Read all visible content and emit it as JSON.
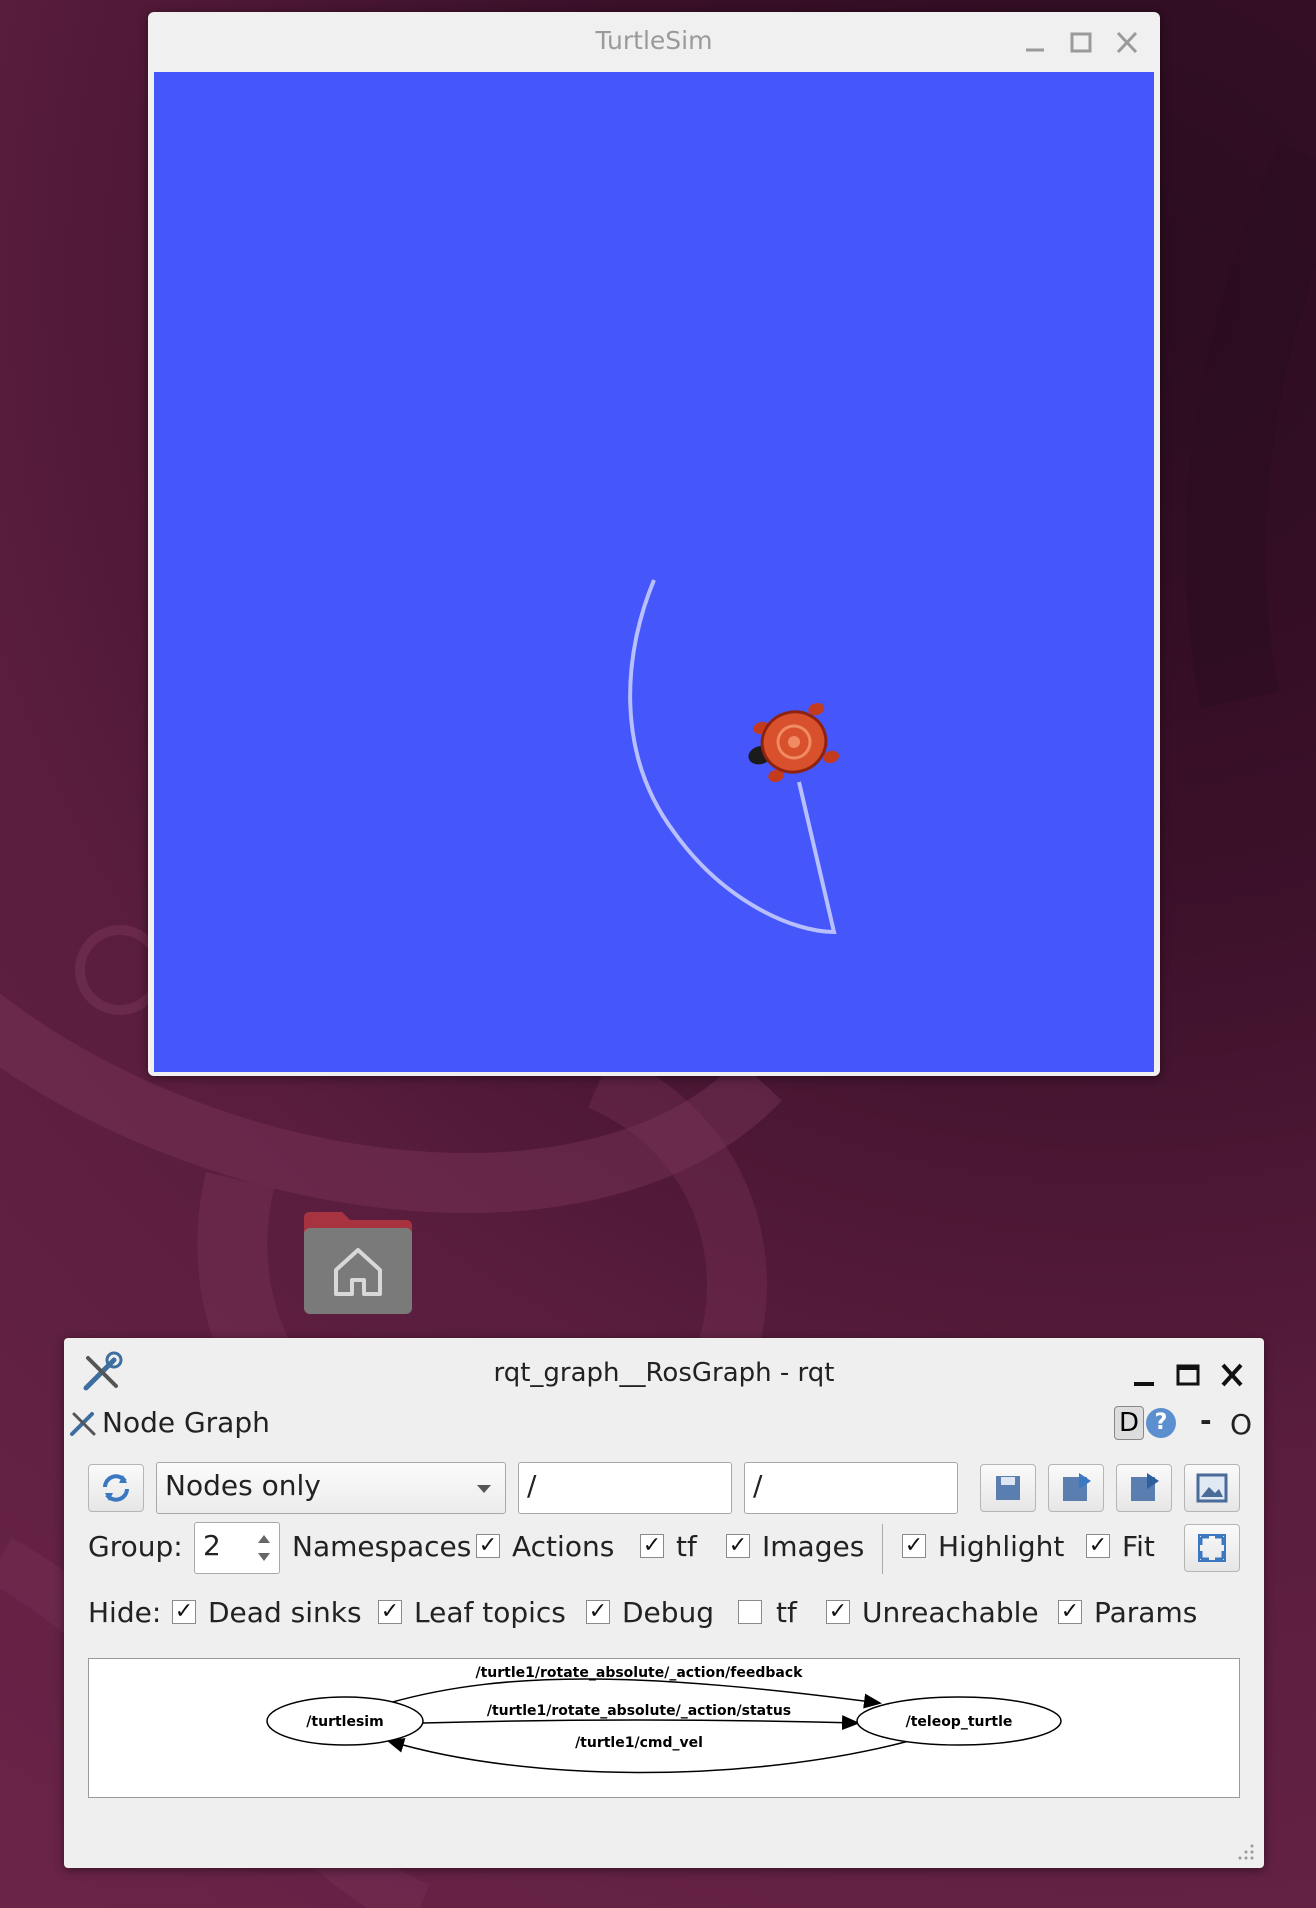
{
  "turtlesim": {
    "title": "TurtleSim",
    "background_color": "#4556fa",
    "icons": [
      "minimize-icon",
      "maximize-icon",
      "close-icon"
    ]
  },
  "desktop": {
    "home_icon": "home-folder-icon"
  },
  "rqt": {
    "title": "rqt_graph__RosGraph - rqt",
    "plugin_title": "Node Graph",
    "plugin_controls": [
      "D",
      "?",
      "-",
      "O"
    ],
    "graph_mode": "Nodes only",
    "ns_filter": "/",
    "topic_filter": "/",
    "group_label": "Group:",
    "group_value": "2",
    "row1_checks": [
      {
        "label": "Namespaces",
        "checked": true
      },
      {
        "label": "Actions",
        "checked": true
      },
      {
        "label": "tf",
        "checked": true
      },
      {
        "label": "Images",
        "checked": true
      },
      {
        "label": "Highlight",
        "checked": true
      },
      {
        "label": "Fit",
        "checked": true
      }
    ],
    "hide_label": "Hide:",
    "hide_checks": [
      {
        "label": "Dead sinks",
        "checked": true
      },
      {
        "label": "Leaf topics",
        "checked": true
      },
      {
        "label": "Debug",
        "checked": true
      },
      {
        "label": "tf",
        "checked": false
      },
      {
        "label": "Unreachable",
        "checked": true
      },
      {
        "label": "Params",
        "checked": true
      }
    ],
    "graph": {
      "nodes": [
        "/turtlesim",
        "/teleop_turtle"
      ],
      "edges": [
        "/turtle1/rotate_absolute/_action/feedback",
        "/turtle1/rotate_absolute/_action/status",
        "/turtle1/cmd_vel"
      ]
    }
  }
}
